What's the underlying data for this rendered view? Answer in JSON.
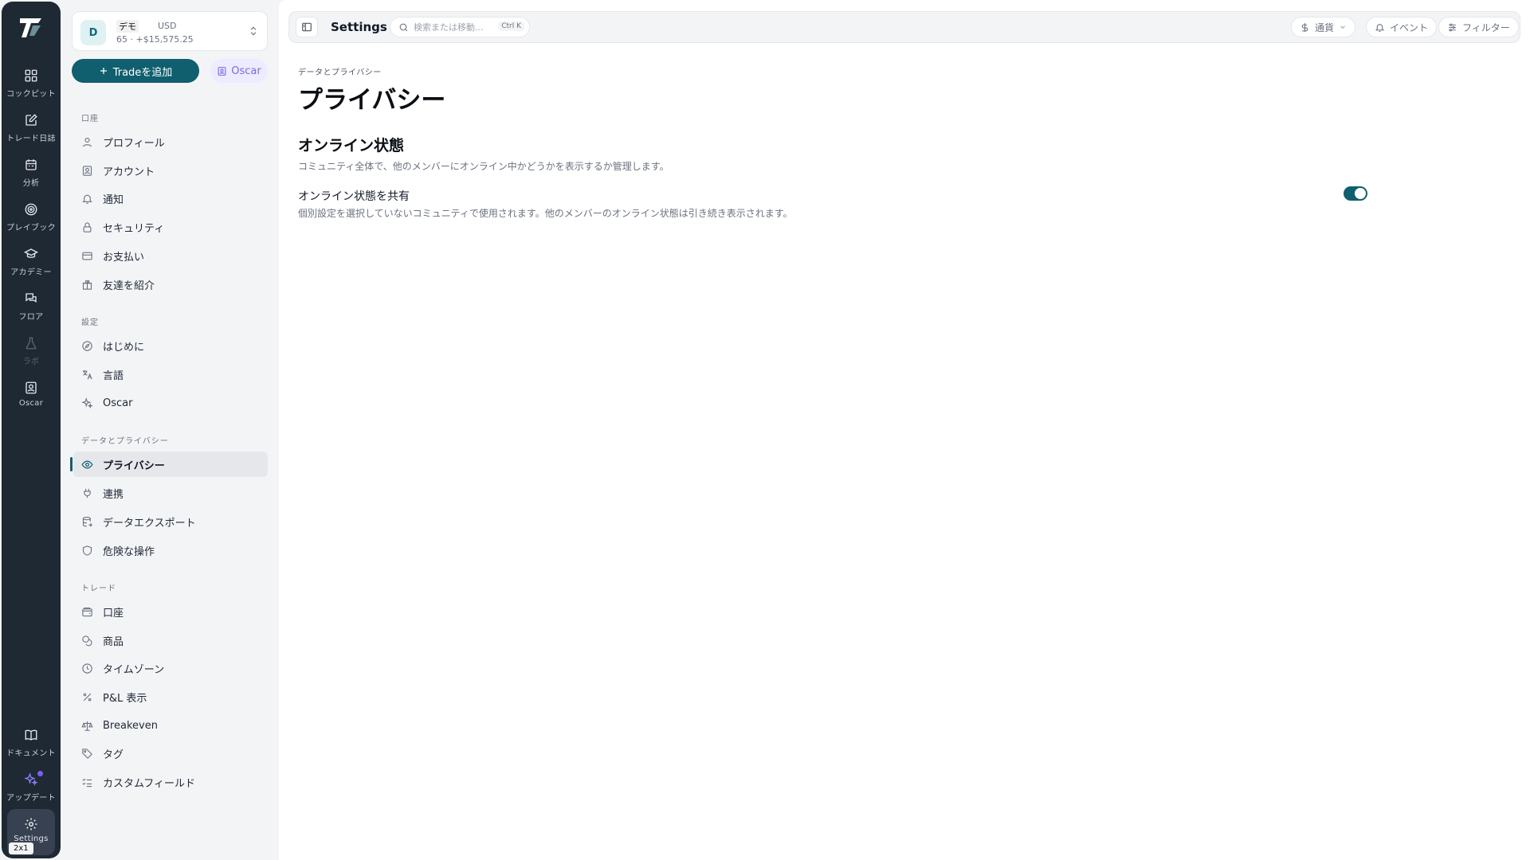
{
  "rail": {
    "items": [
      {
        "label": "コックピット",
        "icon": "grid-icon"
      },
      {
        "label": "トレード日誌",
        "icon": "journal-icon"
      },
      {
        "label": "分析",
        "icon": "calendar-icon"
      },
      {
        "label": "プレイブック",
        "icon": "target-icon"
      },
      {
        "label": "アカデミー",
        "icon": "graduation-cap-icon"
      },
      {
        "label": "フロア",
        "icon": "chat-icon"
      },
      {
        "label": "ラボ",
        "icon": "flask-icon"
      },
      {
        "label": "Oscar",
        "icon": "oscar-icon"
      }
    ],
    "bottom": [
      {
        "label": "ドキュメント",
        "icon": "book-icon"
      },
      {
        "label": "アップデート",
        "icon": "sparkle-icon"
      }
    ],
    "settings_label": "Settings",
    "badge": "2x1"
  },
  "account": {
    "avatar": "D",
    "tag": "デモ",
    "currency": "USD",
    "stats": "65 · +$15,575.25"
  },
  "sidebar": {
    "add_trade": "Tradeを追加",
    "oscar": "Oscar",
    "sections": [
      {
        "title": "口座",
        "items": [
          "プロフィール",
          "アカウント",
          "通知",
          "セキュリティ",
          "お支払い",
          "友達を紹介"
        ]
      },
      {
        "title": "設定",
        "items": [
          "はじめに",
          "言語",
          "Oscar"
        ]
      },
      {
        "title": "データとプライバシー",
        "items": [
          "プライバシー",
          "連携",
          "データエクスポート",
          "危険な操作"
        ]
      },
      {
        "title": "トレード",
        "items": [
          "口座",
          "商品",
          "タイムゾーン",
          "P&L 表示",
          "Breakeven",
          "タグ",
          "カスタムフィールド"
        ]
      }
    ],
    "active": "プライバシー"
  },
  "topbar": {
    "title": "Settings",
    "search_placeholder": "検索または移動...",
    "shortcut": "Ctrl K",
    "currency": "通貨",
    "events": "イベント",
    "filter": "フィルター"
  },
  "content": {
    "breadcrumb": "データとプライバシー",
    "title": "プライバシー",
    "section_title": "オンライン状態",
    "section_desc": "コミュニティ全体で、他のメンバーにオンライン中かどうかを表示するか管理します。",
    "setting_label": "オンライン状態を共有",
    "setting_desc": "個別設定を選択していないコミュニティで使用されます。他のメンバーのオンライン状態は引き続き表示されます。",
    "toggle_on": true
  },
  "colors": {
    "accent": "#0f5f6e",
    "rail": "#1f2933",
    "oscar": "#7c6adf"
  }
}
